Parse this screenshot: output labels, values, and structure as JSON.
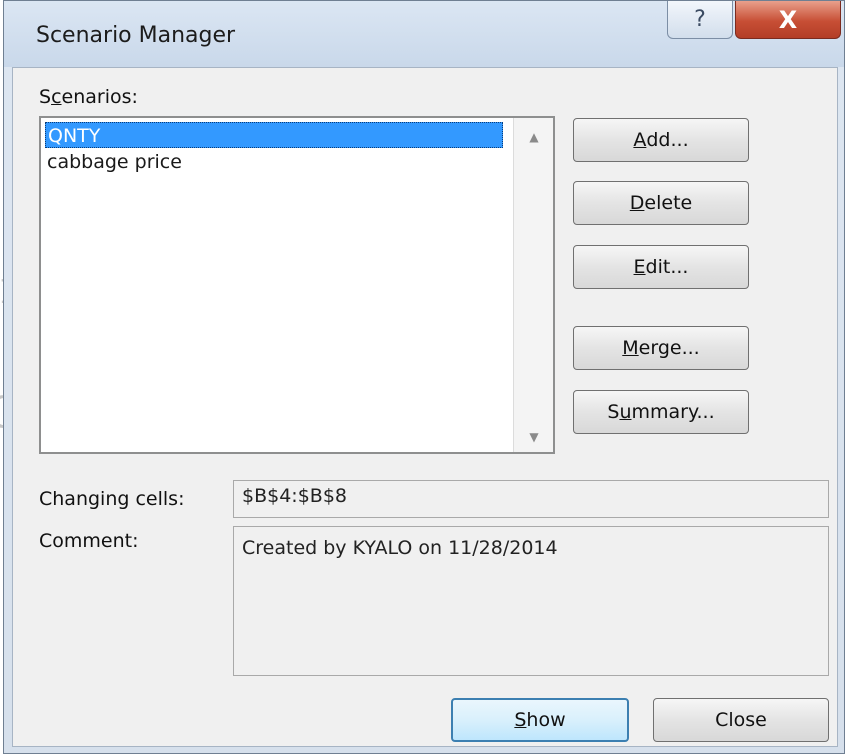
{
  "window": {
    "title": "Scenario Manager",
    "help_symbol": "?",
    "close_symbol": "X"
  },
  "scenarios": {
    "label": "Scenarios:",
    "items": [
      {
        "label": "QNTY",
        "selected": true
      },
      {
        "label": "cabbage price",
        "selected": false
      }
    ]
  },
  "buttons": {
    "add": "Add...",
    "delete": "Delete",
    "edit": "Edit...",
    "merge": "Merge...",
    "summary": "Summary...",
    "show": "Show",
    "close": "Close"
  },
  "changing_cells": {
    "label": "Changing cells:",
    "value": "$B$4:$B$8"
  },
  "comment": {
    "label": "Comment:",
    "value": "Created by KYALO on 11/28/2014"
  },
  "colors": {
    "selection": "#3399ff",
    "close_button": "#c74e35",
    "title_bar": "#c9d8ea"
  },
  "icons": {
    "help": "help-icon",
    "close": "close-icon",
    "scroll_up": "scroll-up-arrow-icon",
    "scroll_down": "scroll-down-arrow-icon"
  }
}
